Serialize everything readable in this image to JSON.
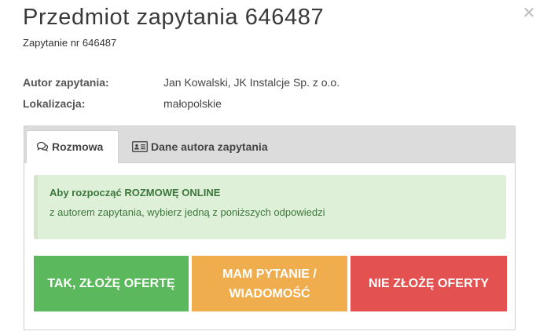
{
  "modal": {
    "title": "Przedmiot zapytania 646487",
    "subtitle": "Zapytanie nr 646487",
    "close_icon": "close-icon"
  },
  "meta": {
    "author_label": "Autor zapytania:",
    "author_value": "Jan Kowalski, JK Instalcje Sp. z o.o.",
    "location_label": "Lokalizacja:",
    "location_value": "małopolskie"
  },
  "tabs": [
    {
      "label": "Rozmowa",
      "icon": "chat-bubbles-icon",
      "active": true
    },
    {
      "label": "Dane autora zapytania",
      "icon": "id-card-icon",
      "active": false
    }
  ],
  "alert": {
    "line1": "Aby rozpocząć ROZMOWĘ ONLINE",
    "line2": "z autorem zapytania, wybierz jedną z poniższych odpowiedzi"
  },
  "actions": {
    "offer": "TAK, ZŁOŻĘ OFERTĘ",
    "question_line1": "MAM PYTANIE /",
    "question_line2": "WIADOMOŚĆ",
    "decline": "NIE ZŁOŻĘ OFERTY"
  },
  "colors": {
    "offer": "#5cb85c",
    "question": "#f0ad4e",
    "decline": "#e35151",
    "alert_bg": "#dff0d8",
    "alert_text": "#3c763d"
  }
}
